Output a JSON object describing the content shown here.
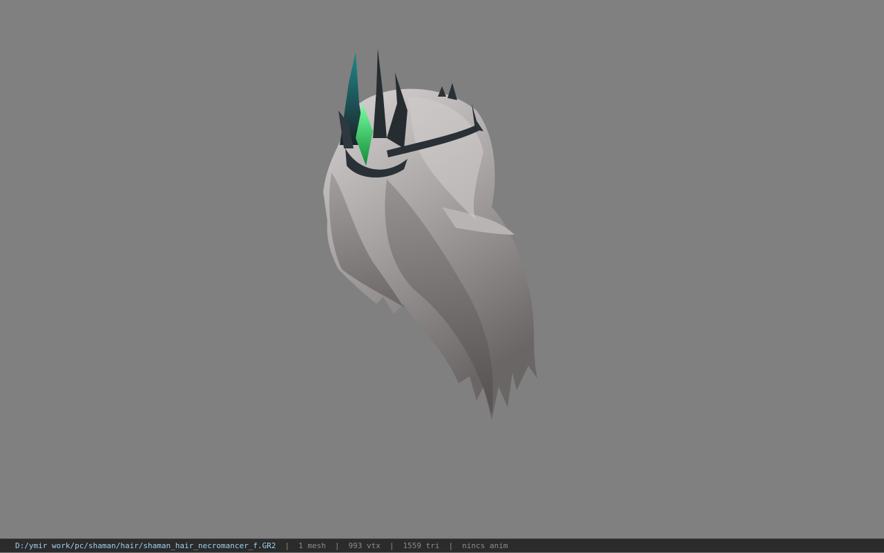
{
  "viewport": {
    "background": "#808080",
    "model": {
      "name": "shaman_hair_necromancer_f",
      "hair_color": "#b8b4b4",
      "crown_metal_color": "#2a3136",
      "crown_gem_color": "#2fd05a"
    }
  },
  "status_bar": {
    "path": "D:/ymir work/pc/shaman/hair/shaman_hair_necromancer_f.GR2",
    "meshes": "1 mesh",
    "vertices": "993 vtx",
    "triangles": "1559 tri",
    "animation": "nincs anim",
    "separator": "|",
    "path_color": "#9fd0ee",
    "text_color": "#8c8c8c"
  }
}
